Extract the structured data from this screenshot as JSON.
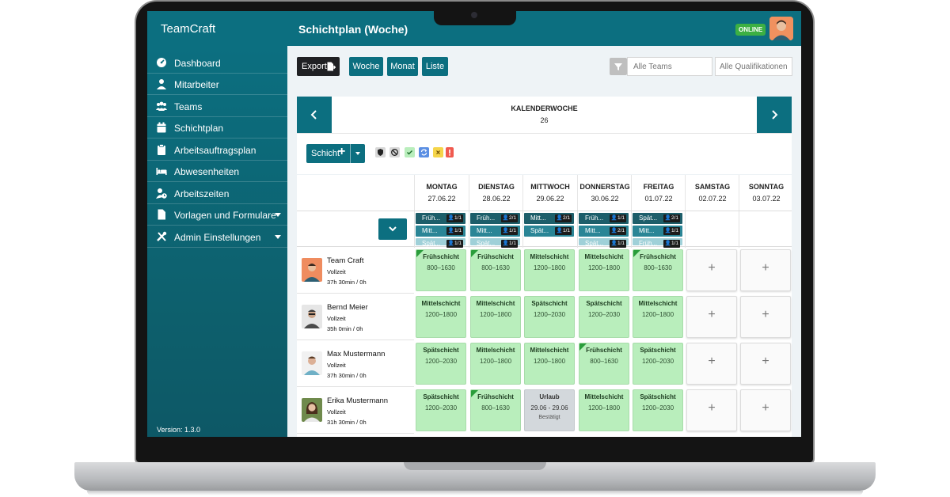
{
  "app": {
    "brand": "TeamCraft",
    "page_title": "Schichtplan (Woche)",
    "status": "ONLINE",
    "version": "Version: 1.3.0"
  },
  "sidebar": {
    "items": [
      {
        "label": "Dashboard",
        "icon": "dashboard-icon"
      },
      {
        "label": "Mitarbeiter",
        "icon": "user-icon"
      },
      {
        "label": "Teams",
        "icon": "users-icon"
      },
      {
        "label": "Schichtplan",
        "icon": "calendar-icon"
      },
      {
        "label": "Arbeitsauftragsplan",
        "icon": "clipboard-icon"
      },
      {
        "label": "Abwesenheiten",
        "icon": "bed-icon"
      },
      {
        "label": "Arbeitszeiten",
        "icon": "user-clock-icon"
      },
      {
        "label": "Vorlagen und Formulare",
        "icon": "file-icon",
        "dropdown": true
      },
      {
        "label": "Admin Einstellungen",
        "icon": "tools-icon",
        "dropdown": true
      }
    ]
  },
  "toolbar": {
    "export_label": "Export",
    "view_week": "Woche",
    "view_month": "Monat",
    "view_list": "Liste",
    "teams_placeholder": "Alle Teams",
    "quals_placeholder": "Alle Qualifikationen"
  },
  "week": {
    "title": "KALENDERWOCHE",
    "number": "26"
  },
  "tools": {
    "shift_button": "Schicht",
    "plus": "+"
  },
  "days": [
    {
      "name": "MONTAG",
      "date": "27.06.22"
    },
    {
      "name": "DIENSTAG",
      "date": "28.06.22"
    },
    {
      "name": "MITTWOCH",
      "date": "29.06.22"
    },
    {
      "name": "DONNERSTAG",
      "date": "30.06.22"
    },
    {
      "name": "FREITAG",
      "date": "01.07.22"
    },
    {
      "name": "SAMSTAG",
      "date": "02.07.22"
    },
    {
      "name": "SONNTAG",
      "date": "03.07.22"
    }
  ],
  "summary": [
    [
      {
        "label": "Früh...",
        "count": "1/1"
      },
      {
        "label": "Mitt...",
        "count": "1/1"
      },
      {
        "label": "Spät...",
        "count": "1/1"
      }
    ],
    [
      {
        "label": "Früh...",
        "count": "2/1"
      },
      {
        "label": "Mitt...",
        "count": "1/1"
      },
      {
        "label": "Spät...",
        "count": "1/1"
      }
    ],
    [
      {
        "label": "Mitt...",
        "count": "2/1"
      },
      {
        "label": "Spät...",
        "count": "1/1"
      }
    ],
    [
      {
        "label": "Früh...",
        "count": "1/1"
      },
      {
        "label": "Mitt...",
        "count": "2/1"
      },
      {
        "label": "Spät...",
        "count": "1/1"
      }
    ],
    [
      {
        "label": "Spät...",
        "count": "2/1"
      },
      {
        "label": "Mitt...",
        "count": "1/1"
      },
      {
        "label": "Früh...",
        "count": "1/1"
      }
    ],
    [],
    []
  ],
  "employees": [
    {
      "name": "Team Craft",
      "type": "Vollzeit",
      "hours": "37h 30min / 0h"
    },
    {
      "name": "Bernd Meier",
      "type": "Vollzeit",
      "hours": "35h 0min / 0h"
    },
    {
      "name": "Max Mustermann",
      "type": "Vollzeit",
      "hours": "37h 30min / 0h"
    },
    {
      "name": "Erika Mustermann",
      "type": "Vollzeit",
      "hours": "31h 30min / 0h"
    }
  ],
  "schedule": [
    [
      {
        "kind": "shift",
        "title": "Frühschicht",
        "time": "800–1630",
        "flag": true
      },
      {
        "kind": "shift",
        "title": "Frühschicht",
        "time": "800–1630",
        "flag": true
      },
      {
        "kind": "shift",
        "title": "Mittelschicht",
        "time": "1200–1800"
      },
      {
        "kind": "shift",
        "title": "Mittelschicht",
        "time": "1200–1800"
      },
      {
        "kind": "shift",
        "title": "Frühschicht",
        "time": "800–1630",
        "flag": true
      },
      {
        "kind": "empty",
        "title": "+"
      },
      {
        "kind": "empty",
        "title": "+"
      }
    ],
    [
      {
        "kind": "shift",
        "title": "Mittelschicht",
        "time": "1200–1800"
      },
      {
        "kind": "shift",
        "title": "Mittelschicht",
        "time": "1200–1800"
      },
      {
        "kind": "shift",
        "title": "Spätschicht",
        "time": "1200–2030"
      },
      {
        "kind": "shift",
        "title": "Spätschicht",
        "time": "1200–2030"
      },
      {
        "kind": "shift",
        "title": "Mittelschicht",
        "time": "1200–1800"
      },
      {
        "kind": "empty",
        "title": "+"
      },
      {
        "kind": "empty",
        "title": "+"
      }
    ],
    [
      {
        "kind": "shift",
        "title": "Spätschicht",
        "time": "1200–2030"
      },
      {
        "kind": "shift",
        "title": "Mittelschicht",
        "time": "1200–1800"
      },
      {
        "kind": "shift",
        "title": "Mittelschicht",
        "time": "1200–1800"
      },
      {
        "kind": "shift",
        "title": "Frühschicht",
        "time": "800–1630",
        "flag": true
      },
      {
        "kind": "shift",
        "title": "Spätschicht",
        "time": "1200–2030"
      },
      {
        "kind": "empty",
        "title": "+"
      },
      {
        "kind": "empty",
        "title": "+"
      }
    ],
    [
      {
        "kind": "shift",
        "title": "Spätschicht",
        "time": "1200–2030"
      },
      {
        "kind": "shift",
        "title": "Frühschicht",
        "time": "800–1630",
        "flag": true
      },
      {
        "kind": "leave",
        "title": "Urlaub",
        "time": "29.06 - 29.06",
        "status": "Bestätigt"
      },
      {
        "kind": "shift",
        "title": "Mittelschicht",
        "time": "1200–1800"
      },
      {
        "kind": "shift",
        "title": "Spätschicht",
        "time": "1200–2030"
      },
      {
        "kind": "empty",
        "title": "+"
      },
      {
        "kind": "empty",
        "title": "+"
      }
    ]
  ],
  "colors": {
    "primary": "#0c6f80",
    "shift_green": "#b9eebc",
    "online_green": "#3cb043",
    "summary_dark": "#1d5e6a",
    "summary_mid": "#2a8596",
    "summary_light": "#9fd0d8"
  }
}
